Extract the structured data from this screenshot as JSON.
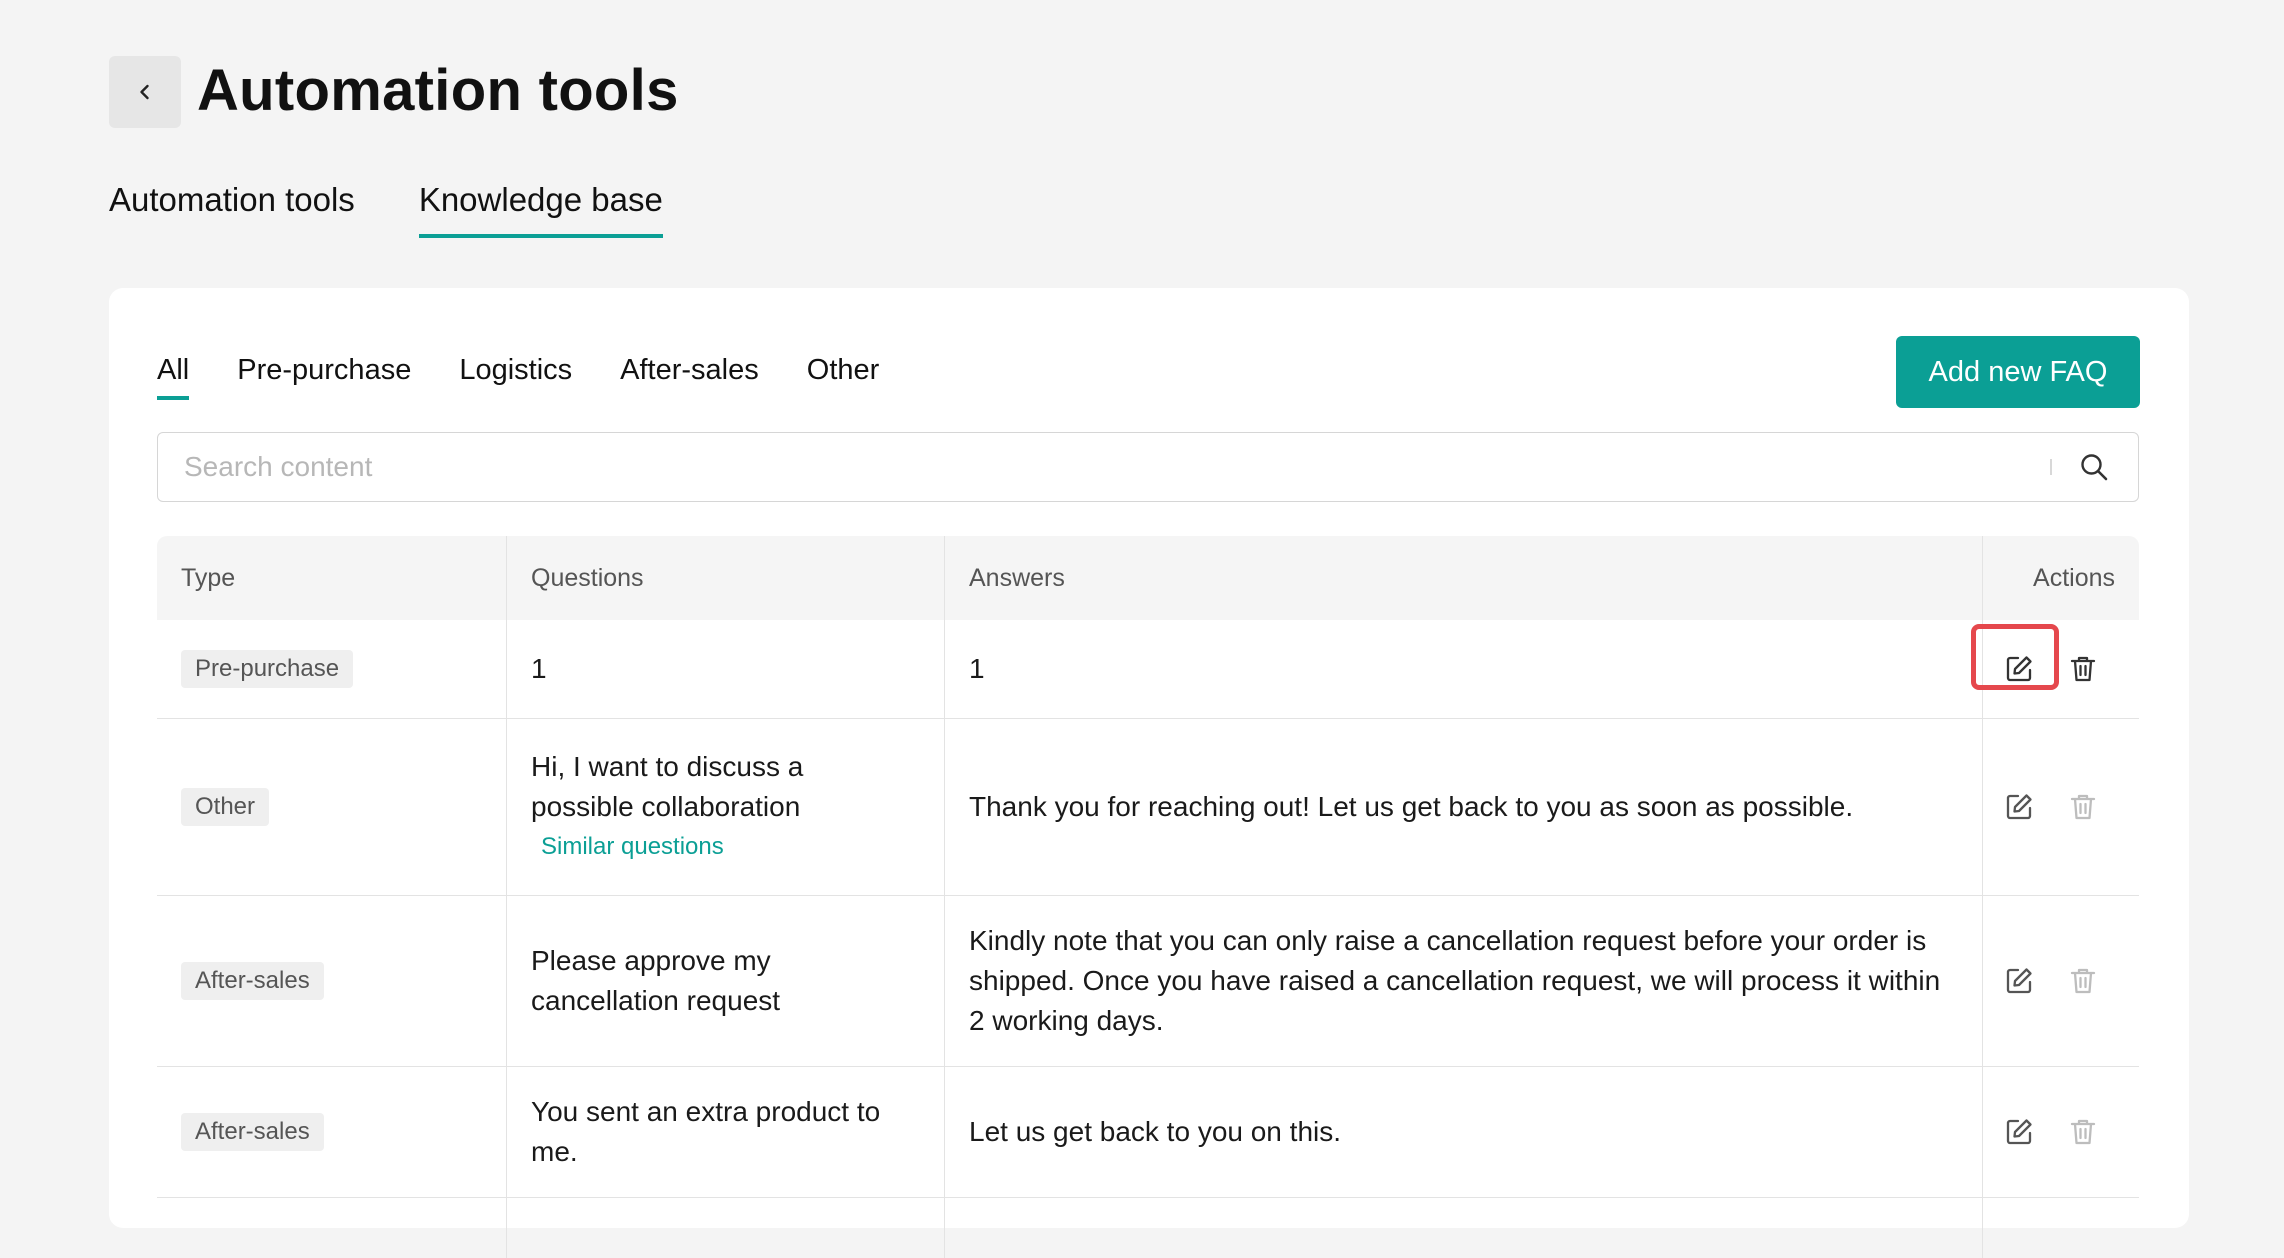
{
  "header": {
    "title": "Automation tools"
  },
  "top_tabs": [
    {
      "label": "Automation tools",
      "active": false
    },
    {
      "label": "Knowledge base",
      "active": true
    }
  ],
  "filter_tabs": [
    {
      "label": "All",
      "active": true
    },
    {
      "label": "Pre-purchase",
      "active": false
    },
    {
      "label": "Logistics",
      "active": false
    },
    {
      "label": "After-sales",
      "active": false
    },
    {
      "label": "Other",
      "active": false
    }
  ],
  "toolbar": {
    "add_label": "Add new FAQ"
  },
  "search": {
    "placeholder": "Search content",
    "value": ""
  },
  "table": {
    "headers": {
      "type": "Type",
      "questions": "Questions",
      "answers": "Answers",
      "actions": "Actions"
    },
    "rows": [
      {
        "type": "Pre-purchase",
        "question_line1": "1",
        "question_line2": "",
        "similar": "",
        "answer": "1"
      },
      {
        "type": "Other",
        "question_line1": "Hi, I want to discuss a",
        "question_line2": "possible collaboration",
        "similar": "Similar questions",
        "answer": "Thank you for reaching out! Let us get back to you as soon as possible."
      },
      {
        "type": "After-sales",
        "question_line1": "Please approve my",
        "question_line2": "cancellation request",
        "similar": "",
        "answer": "Kindly note that you can only raise a cancellation request before your order is shipped. Once you have raised a cancellation request, we will process it within 2 working days."
      },
      {
        "type": "After-sales",
        "question_line1": "You sent an extra product to",
        "question_line2": "me.",
        "similar": "",
        "answer": "Let us get back to you on this."
      }
    ]
  },
  "icons": {
    "back": "chevron-left-icon",
    "search": "search-icon",
    "edit": "edit-icon",
    "delete": "trash-icon"
  },
  "colors": {
    "accent": "#0b9f95",
    "highlight": "#e5484d",
    "background": "#f4f4f4",
    "badge_bg": "#efefef"
  }
}
